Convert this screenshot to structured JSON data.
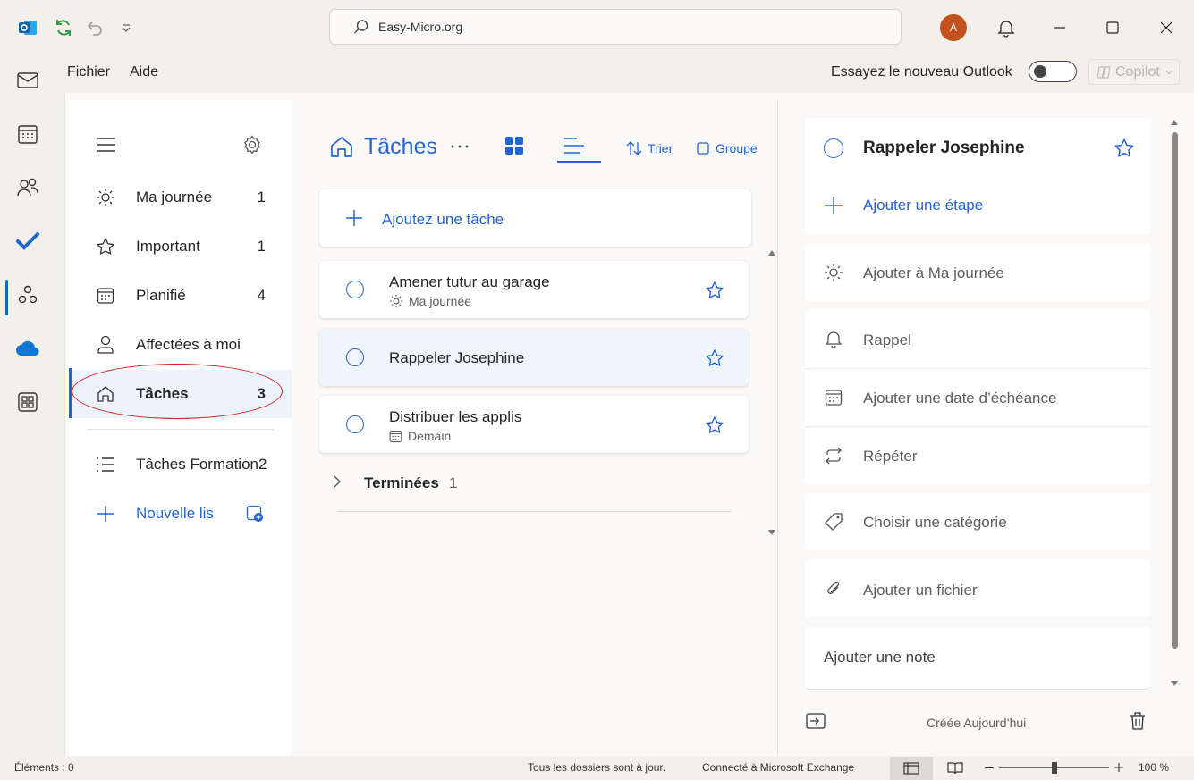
{
  "titlebar": {
    "search_text": "Easy-Micro.org",
    "avatar_initial": "A"
  },
  "menu": {
    "file": "Fichier",
    "help": "Aide",
    "try_new_outlook": "Essayez le nouveau Outlook",
    "copilot": "Copilot"
  },
  "sidebar": {
    "items": [
      {
        "label": "Ma journée",
        "count": "1",
        "icon": "sun-icon"
      },
      {
        "label": "Important",
        "count": "1",
        "icon": "star-icon"
      },
      {
        "label": "Planifié",
        "count": "4",
        "icon": "calendar-icon"
      },
      {
        "label": "Affectées à moi",
        "count": "",
        "icon": "person-icon"
      },
      {
        "label": "Tâches",
        "count": "3",
        "icon": "home-icon"
      }
    ],
    "lists": [
      {
        "label": "Tâches Formation2",
        "icon": "list-icon"
      }
    ],
    "new_list": "Nouvelle lis"
  },
  "tasklist": {
    "title": "Tâches",
    "sort_label": "Trier",
    "group_label": "Groupe",
    "add_task_placeholder": "Ajoutez une tâche",
    "tasks": [
      {
        "title": "Amener tutur au garage",
        "sub": "Ma journée"
      },
      {
        "title": "Rappeler Josephine",
        "sub": ""
      },
      {
        "title": "Distribuer les applis",
        "sub": "Demain"
      }
    ],
    "completed_label": "Terminées",
    "completed_count": "1"
  },
  "detail": {
    "task_title": "Rappeler Josephine",
    "add_step": "Ajouter une étape",
    "add_my_day": "Ajouter à Ma journée",
    "reminder": "Rappel",
    "due_date": "Ajouter une date d’échéance",
    "repeat": "Répéter",
    "category": "Choisir une catégorie",
    "add_file": "Ajouter un fichier",
    "add_note": "Ajouter une note",
    "created": "Créée Aujourd’hui"
  },
  "statusbar": {
    "items": "Éléments : 0",
    "sync": "Tous les dossiers sont à jour.",
    "connection": "Connecté à Microsoft Exchange",
    "zoom": "100 %"
  },
  "colors": {
    "accent": "#2564cf",
    "highlight_ellipse": "#d21c1c"
  }
}
